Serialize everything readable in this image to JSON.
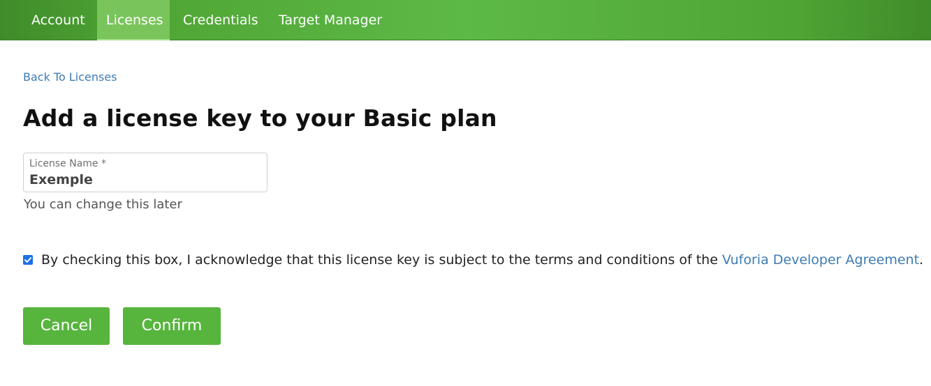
{
  "nav": {
    "items": [
      {
        "label": "Account"
      },
      {
        "label": "Licenses",
        "active": true
      },
      {
        "label": "Credentials"
      },
      {
        "label": "Target Manager"
      }
    ]
  },
  "back_link": "Back To Licenses",
  "title": "Add a license key to your Basic plan",
  "license_field": {
    "label": "License Name *",
    "value": "Exemple"
  },
  "helper_text": "You can change this later",
  "consent": {
    "checked": true,
    "text": "By checking this box, I acknowledge that this license key is subject to the terms and conditions of the ",
    "link": "Vuforia Developer Agreement",
    "suffix": "."
  },
  "buttons": {
    "cancel": "Cancel",
    "confirm": "Confirm"
  },
  "colors": {
    "nav_green": "#5db947",
    "button_green": "#57b43d",
    "link_blue": "#3d7bb5",
    "checkbox_blue": "#1a73e8"
  }
}
